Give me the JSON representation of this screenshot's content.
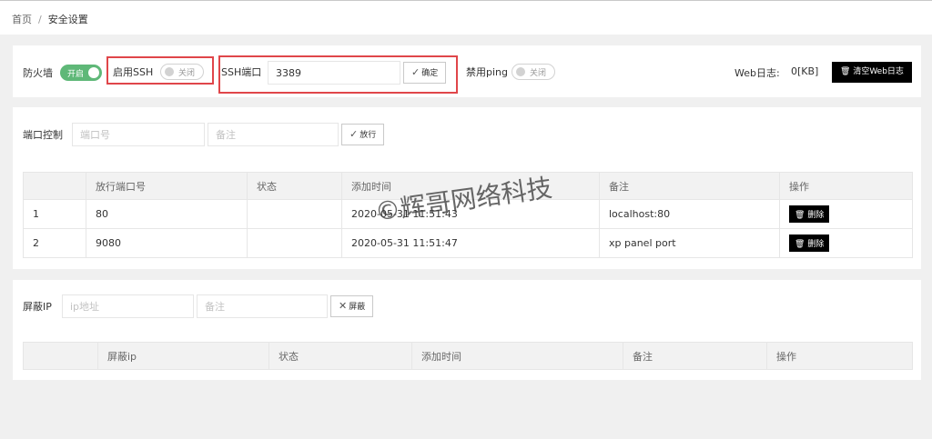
{
  "breadcrumb": {
    "home": "首页",
    "separator": "/",
    "current": "安全设置"
  },
  "firewall": {
    "label": "防火墙",
    "switch_label": "开启",
    "ssh_label": "启用SSH",
    "ssh_switch_label": "关闭",
    "ssh_port_label": "SSH端口",
    "ssh_port_value": "3389",
    "confirm_label": "确定",
    "ping_label": "禁用ping",
    "ping_switch_label": "关闭",
    "weblog_label": "Web日志:",
    "weblog_size": "0[KB]",
    "clear_weblog_label": "清空Web日志"
  },
  "port_control": {
    "label": "端口控制",
    "port_placeholder": "端口号",
    "note_placeholder": "备注",
    "allow_label": "放行",
    "columns": [
      "",
      "放行端口号",
      "状态",
      "添加时间",
      "备注",
      "操作"
    ],
    "rows": [
      {
        "index": "1",
        "port": "80",
        "status": "",
        "time": "2020-05-31 11:51:43",
        "note": "localhost:80",
        "delete_label": "删除"
      },
      {
        "index": "2",
        "port": "9080",
        "status": "",
        "time": "2020-05-31 11:51:47",
        "note": "xp panel port",
        "delete_label": "删除"
      }
    ]
  },
  "block_ip": {
    "label": "屏蔽IP",
    "ip_placeholder": "ip地址",
    "note_placeholder": "备注",
    "block_label": "屏蔽",
    "columns": [
      "",
      "屏蔽ip",
      "状态",
      "添加时间",
      "备注",
      "操作"
    ]
  },
  "watermark": "©辉哥网络科技",
  "colors": {
    "switch_on": "#5fb878",
    "highlight_border": "#e0464a",
    "dark_button": "#000000"
  }
}
